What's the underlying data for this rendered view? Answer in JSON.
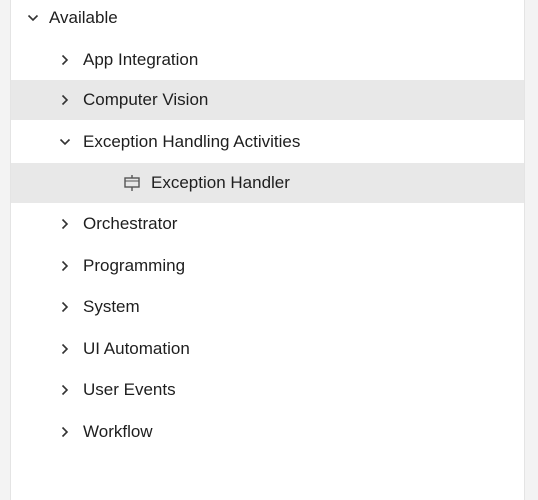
{
  "tree": {
    "root": {
      "label": "Available",
      "expanded": true,
      "children": [
        {
          "label": "App Integration",
          "expanded": false
        },
        {
          "label": "Computer Vision",
          "expanded": false,
          "highlighted": true
        },
        {
          "label": "Exception Handling Activities",
          "expanded": true,
          "children": [
            {
              "label": "Exception Handler",
              "icon": "exception-handler-icon",
              "selected": true
            }
          ]
        },
        {
          "label": "Orchestrator",
          "expanded": false
        },
        {
          "label": "Programming",
          "expanded": false
        },
        {
          "label": "System",
          "expanded": false
        },
        {
          "label": "UI Automation",
          "expanded": false
        },
        {
          "label": "User Events",
          "expanded": false
        },
        {
          "label": "Workflow",
          "expanded": false
        }
      ]
    }
  },
  "colors": {
    "highlight": "#e8e8e8",
    "text": "#1e1e1e",
    "chevron": "#333333",
    "panel": "#ffffff",
    "background": "#f3f3f3"
  }
}
